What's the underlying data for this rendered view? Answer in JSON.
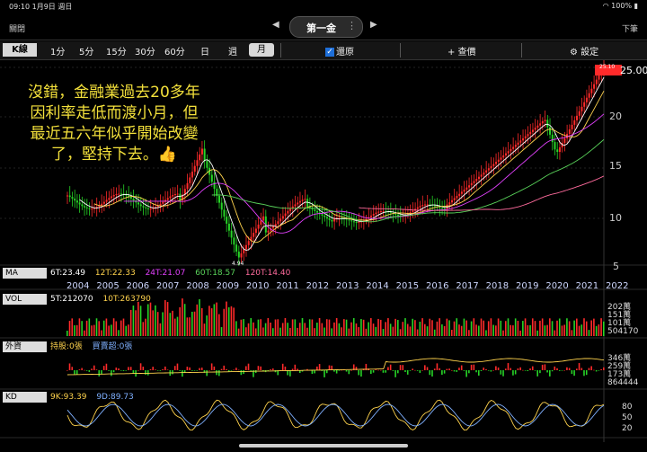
{
  "status_bar": {
    "time": "09:10",
    "date": "1月9日 週日",
    "battery": "100%"
  },
  "nav": {
    "close": "關閉",
    "stock_name": "第一金",
    "next": "下筆",
    "dots": "⋮"
  },
  "toolbar": {
    "k_line": "K線",
    "periods": [
      "1分",
      "5分",
      "15分",
      "30分",
      "60分",
      "日",
      "週"
    ],
    "month": "月",
    "restore": "還原",
    "add": "+ 查價",
    "settings": "設定"
  },
  "overlay_text": {
    "line1": "沒錯，金融業過去20多年",
    "line2": "因利率走低而渡小月，但",
    "line3": "最近五六年似乎開始改變",
    "line4": "了，堅持下去。👍"
  },
  "price_axis": {
    "current": "25.00",
    "current_small": "25.10",
    "ticks": [
      "20",
      "15",
      "10",
      "5"
    ],
    "low_label": "4.94"
  },
  "ma_row": {
    "label": "MA",
    "values": [
      "6T:23.49",
      "12T:22.33",
      "24T:21.07",
      "60T:18.57",
      "120T:14.40"
    ],
    "colors": [
      "#ffffff",
      "#ffd34d",
      "#e040fb",
      "#59d35a",
      "#ff6b9d"
    ]
  },
  "years": [
    "2004",
    "2005",
    "2006",
    "2007",
    "2008",
    "2009",
    "2010",
    "2011",
    "2012",
    "2013",
    "2014",
    "2015",
    "2016",
    "2017",
    "2018",
    "2019",
    "2020",
    "2021",
    "2022"
  ],
  "vol_row": {
    "label": "VOL",
    "values": [
      "5T:212070",
      "10T:263790"
    ],
    "axis": [
      "202萬",
      "151萬",
      "101萬",
      "504170"
    ]
  },
  "foreign_row": {
    "label": "外資",
    "values": [
      "持股:0張",
      "買賣超:0張"
    ],
    "axis": [
      "346萬",
      "259萬",
      "173萬",
      "864444"
    ]
  },
  "kd_row": {
    "label": "KD",
    "values": [
      "9K:93.39",
      "9D:89.73"
    ],
    "axis": [
      "80",
      "50",
      "20"
    ]
  },
  "colors": {
    "up": "#ff2a2a",
    "down": "#27d427",
    "ma_white": "#ffffff",
    "ma_yellow": "#ffd34d",
    "ma_purple": "#e040fb",
    "ma_green": "#59d35a",
    "ma_pink": "#ff6b9d"
  }
}
